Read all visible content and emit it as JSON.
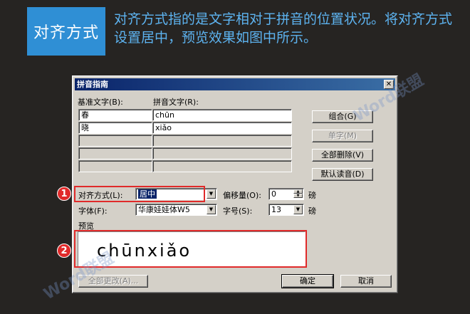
{
  "header": {
    "tag": "对齐方式",
    "description": "对齐方式指的是文字相对于拼音的位置状况。将对齐方式设置居中，预览效果如图中所示。"
  },
  "dialog": {
    "title": "拼音指南",
    "close_glyph": "✕",
    "base_text_label": "基准文字(B):",
    "ruby_text_label": "拼音文字(R):",
    "rows": [
      {
        "base": "春",
        "ruby": "chūn"
      },
      {
        "base": "晓",
        "ruby": "xiǎo"
      },
      {
        "base": "",
        "ruby": ""
      },
      {
        "base": "",
        "ruby": ""
      },
      {
        "base": "",
        "ruby": ""
      }
    ],
    "buttons": {
      "group": "组合(G)",
      "mono": "单字(M)",
      "clear_all": "全部删除(V)",
      "default_reading": "默认读音(D)",
      "apply_all": "全部更改(A)...",
      "ok": "确定",
      "cancel": "取消"
    },
    "alignment_label": "对齐方式(L):",
    "alignment_value": "居中",
    "offset_label": "偏移量(O):",
    "offset_value": "0",
    "offset_unit": "磅",
    "font_label": "字体(F):",
    "font_value": "华康娃娃体W5",
    "size_label": "字号(S):",
    "size_value": "13",
    "size_unit": "磅",
    "preview_label": "预览",
    "preview_text": "chūnxiǎo"
  },
  "annotations": {
    "badge1": "1",
    "badge2": "2"
  },
  "watermarks": {
    "top": "Word联盟",
    "bottom": "Word联盟"
  },
  "colors": {
    "header_bg": "#2f8fd5",
    "header_text": "#5db3f0",
    "annotation_red": "#e02a2a"
  }
}
